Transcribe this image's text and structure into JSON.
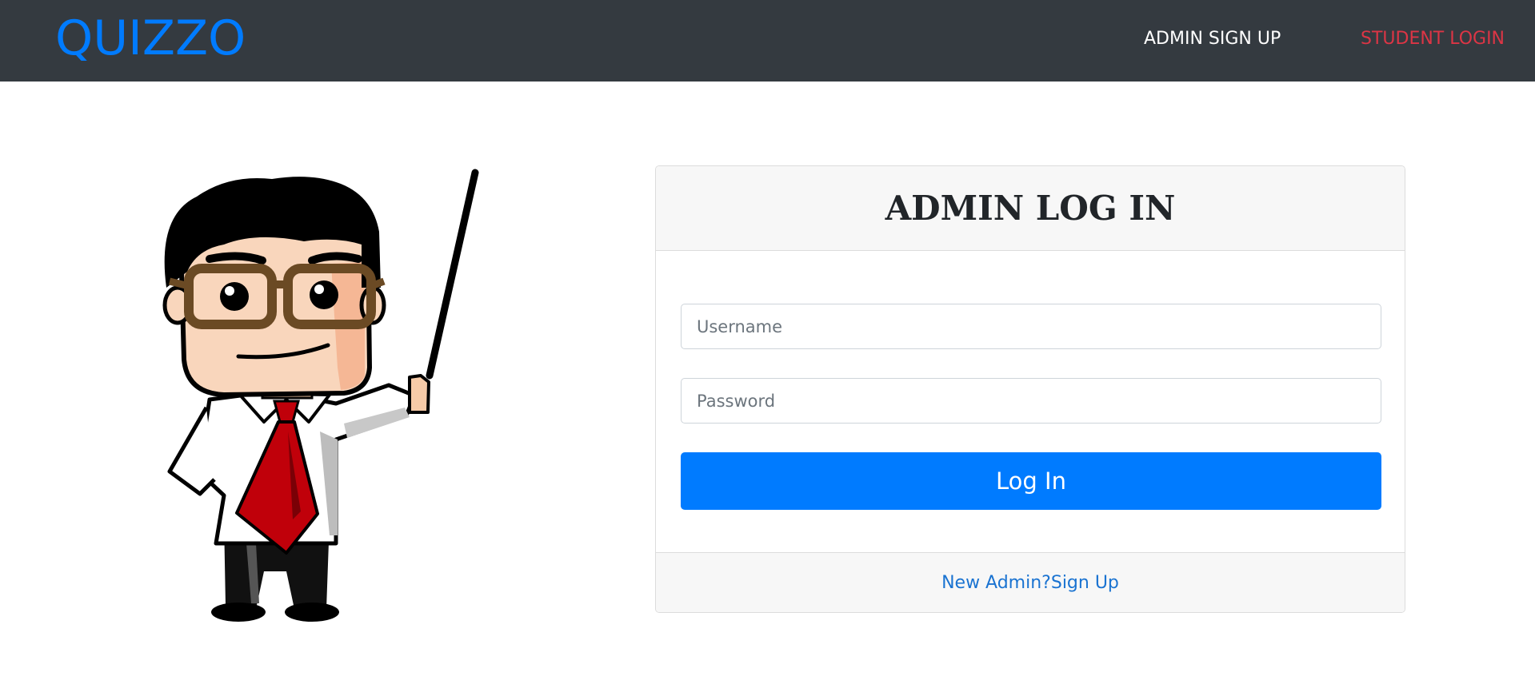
{
  "navbar": {
    "brand": "QUIZZO",
    "links": [
      {
        "label": "ADMIN SIGN UP",
        "color": "#ffffff"
      },
      {
        "label": "STUDENT LOGIN",
        "color": "#dc3545"
      }
    ]
  },
  "illustration": {
    "subject": "cartoon teacher with pointer stick"
  },
  "login_card": {
    "title": "ADMIN LOG IN",
    "username_placeholder": "Username",
    "password_placeholder": "Password",
    "submit_label": "Log In",
    "signup_prompt": "New Admin?Sign Up"
  },
  "colors": {
    "navbar_bg": "#343a40",
    "brand": "#007bff",
    "primary_button": "#007bff",
    "student_login_link": "#dc3545"
  }
}
